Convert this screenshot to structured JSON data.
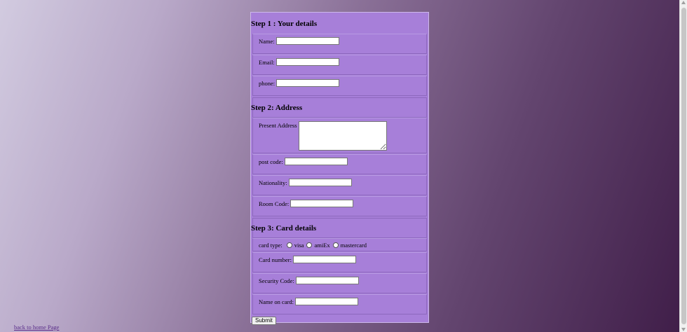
{
  "step1": {
    "title": "Step 1 : Your details",
    "name_label": "Name:",
    "email_label": "Email:",
    "phone_label": "phone:"
  },
  "step2": {
    "title": "Step 2: Address",
    "address_label": "Present Address",
    "postcode_label": "post code:",
    "nationality_label": "Nationality:",
    "roomcode_label": "Room Code:"
  },
  "step3": {
    "title": "Step 3: Card details",
    "cardtype_label": "card type:",
    "card_options": [
      "visa",
      "amiEx",
      "mastercard"
    ],
    "cardnumber_label": "Card number:",
    "security_label": "Security Code:",
    "nameoncard_label": "Name on card:"
  },
  "submit_label": "Submit",
  "back_link_label": "back to home Page"
}
